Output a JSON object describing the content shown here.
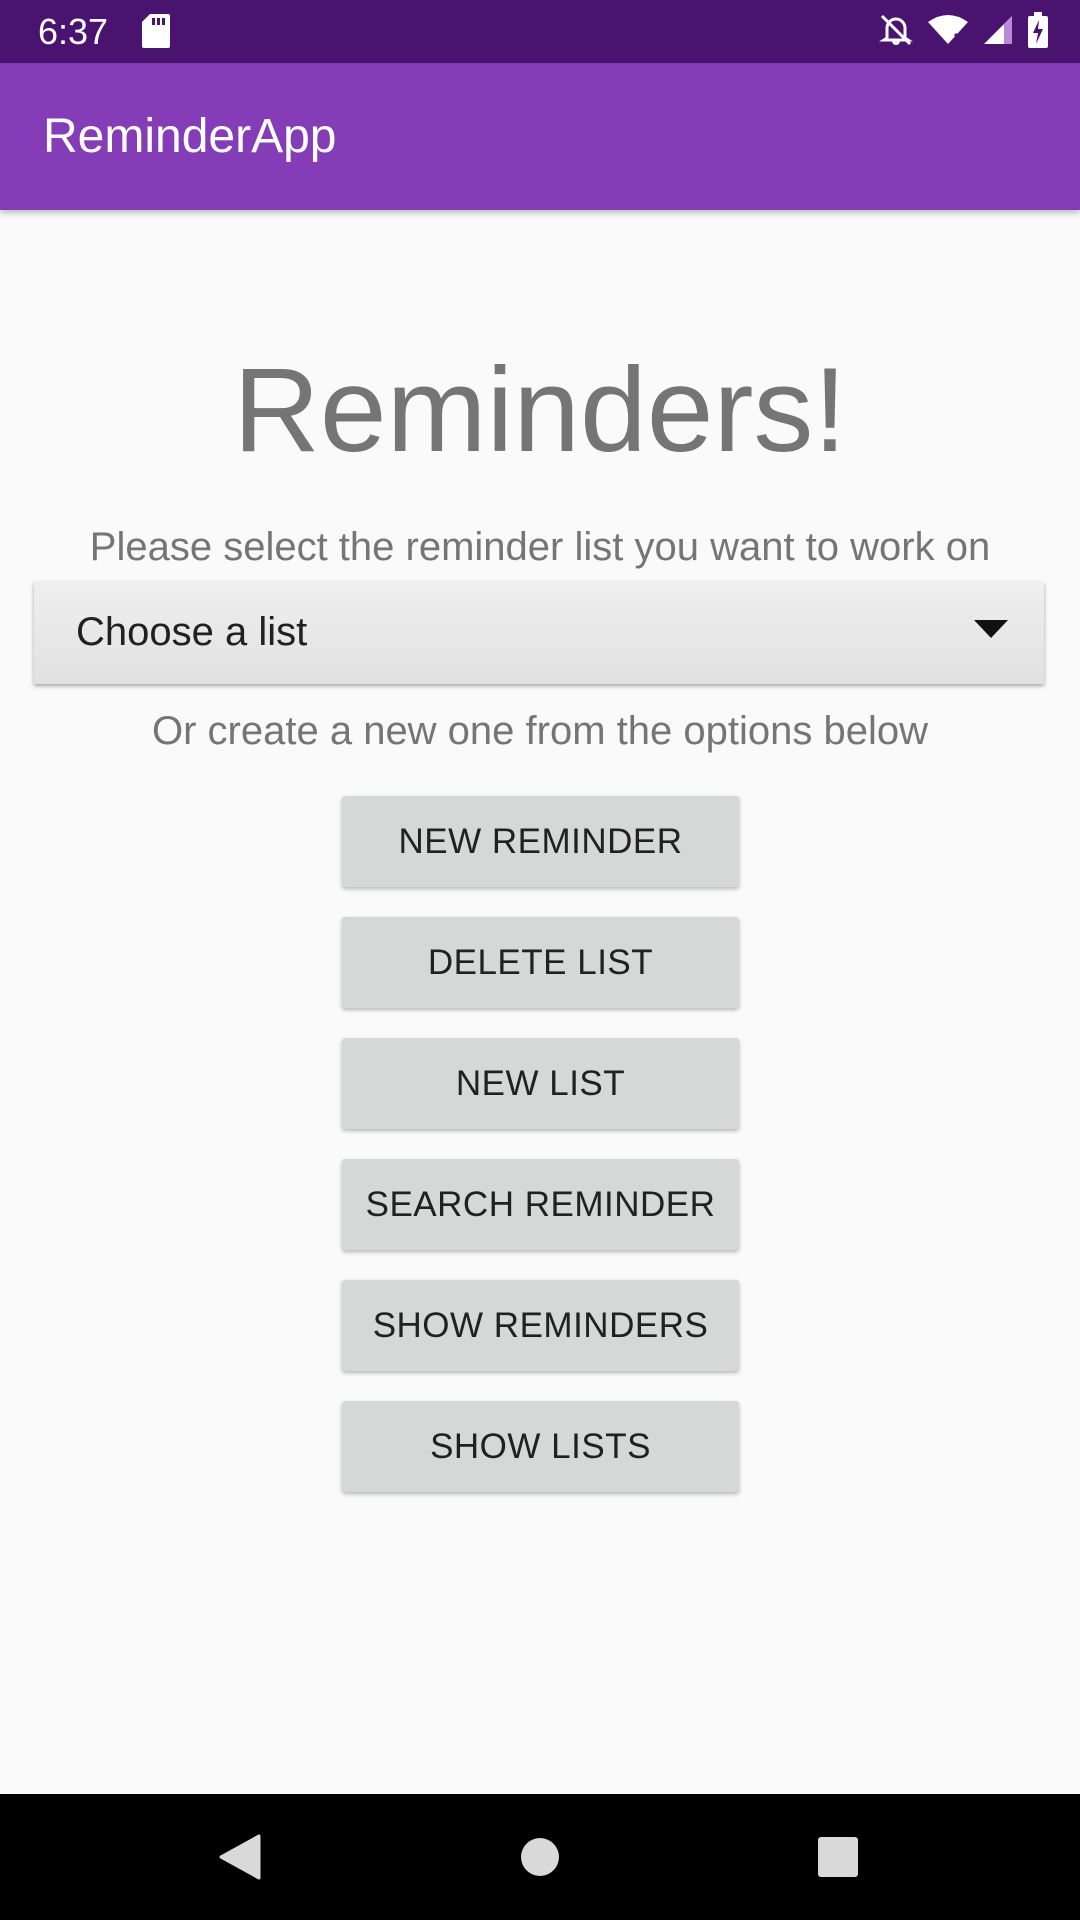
{
  "status_bar": {
    "time": "6:37",
    "icons": [
      "sd-card-icon",
      "notifications-off-icon",
      "wifi-icon",
      "cell-signal-icon",
      "battery-charging-icon"
    ],
    "background": "#4a136f"
  },
  "app_bar": {
    "title": "ReminderApp",
    "background": "#843cb7"
  },
  "main": {
    "heading": "Reminders!",
    "prompt": "Please select the reminder list you want to work on",
    "spinner": {
      "selected": "Choose a list",
      "icon": "dropdown-arrow-icon"
    },
    "subprompt": "Or create a new one from the options below",
    "buttons": {
      "new_reminder": "NEW REMINDER",
      "delete_list": "DELETE LIST",
      "new_list": "NEW LIST",
      "search_reminder": "SEARCH REMINDER",
      "show_reminders": "SHOW REMINDERS",
      "show_lists": "SHOW LISTS"
    }
  },
  "nav_bar": {
    "icons": [
      "back-icon",
      "home-icon",
      "recents-icon"
    ]
  }
}
